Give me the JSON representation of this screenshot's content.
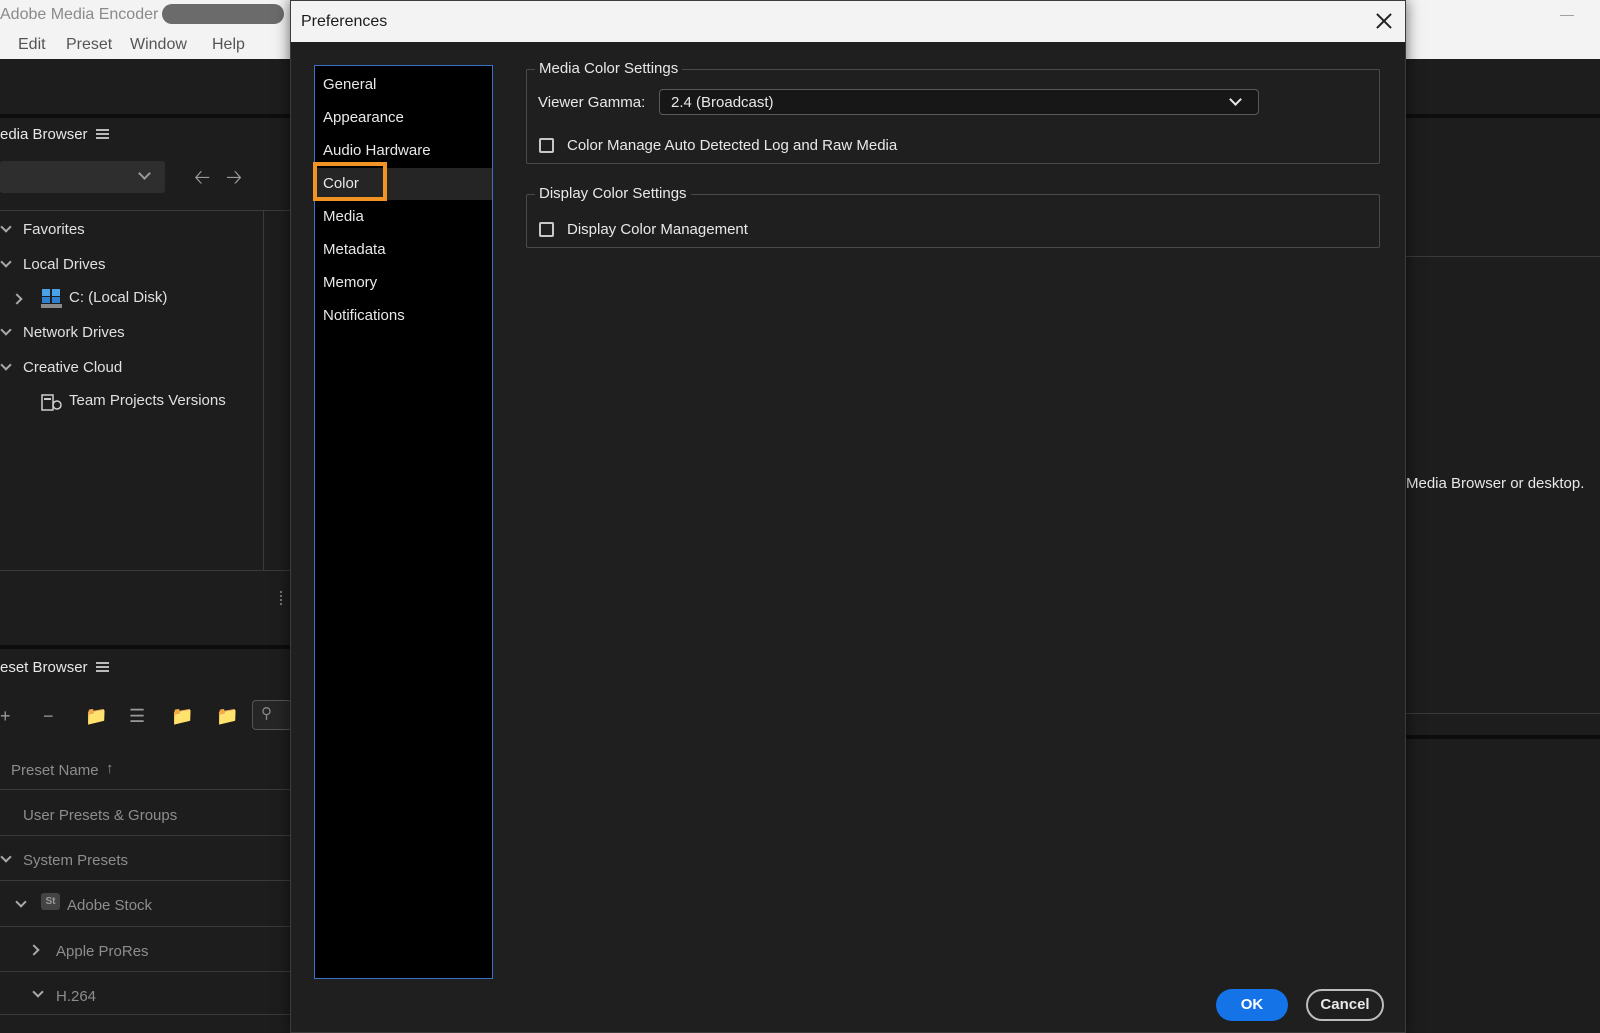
{
  "app": {
    "title": "Adobe Media Encoder",
    "menu": [
      "Edit",
      "Preset",
      "Window",
      "Help"
    ]
  },
  "media_browser": {
    "title": "edia Browser",
    "tree": [
      {
        "label": "Favorites",
        "expanded": true
      },
      {
        "label": "Local Drives",
        "expanded": true
      },
      {
        "label": "C: (Local Disk)",
        "expanded": false,
        "icon": "disk-icon"
      },
      {
        "label": "Network Drives",
        "expanded": true
      },
      {
        "label": "Creative Cloud",
        "expanded": true
      },
      {
        "label": "Team Projects Versions",
        "icon": "team-projects-icon"
      }
    ]
  },
  "preset_browser": {
    "title": "eset Browser",
    "column_header": "Preset Name",
    "rows": [
      {
        "label": "User Presets & Groups"
      },
      {
        "label": "System Presets",
        "expanded": true
      },
      {
        "label": "Adobe Stock",
        "expanded": true,
        "icon_text": "St"
      },
      {
        "label": "Apple ProRes",
        "expanded": false
      },
      {
        "label": "H.264",
        "expanded": true
      }
    ]
  },
  "queue": {
    "hint": "Media Browser or desktop."
  },
  "dialog": {
    "title": "Preferences",
    "categories": [
      "General",
      "Appearance",
      "Audio Hardware",
      "Color",
      "Media",
      "Metadata",
      "Memory",
      "Notifications"
    ],
    "selected_category": "Color",
    "media_color": {
      "legend": "Media Color Settings",
      "viewer_gamma_label": "Viewer Gamma:",
      "viewer_gamma_value": "2.4 (Broadcast)",
      "auto_detect_label": "Color Manage Auto Detected Log and Raw Media",
      "auto_detect_checked": false
    },
    "display_color": {
      "legend": "Display Color Settings",
      "display_management_label": "Display Color Management",
      "display_management_checked": false
    },
    "ok_label": "OK",
    "cancel_label": "Cancel"
  },
  "colors": {
    "accent_blue": "#1473e6",
    "highlight_orange": "#f29423",
    "list_border": "#3b72c8"
  }
}
